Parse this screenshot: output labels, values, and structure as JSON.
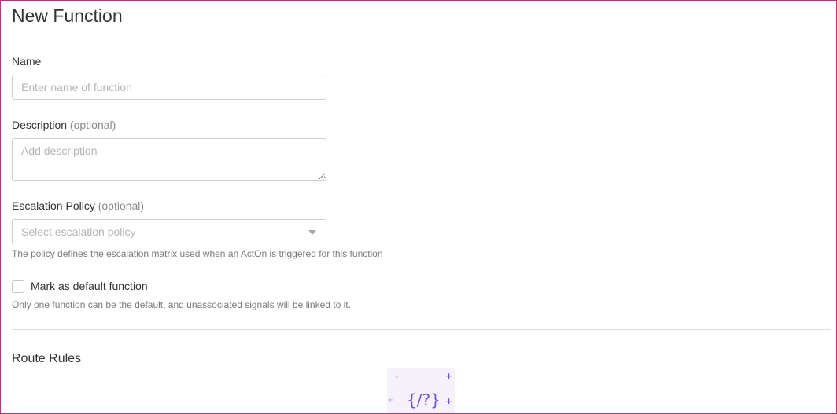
{
  "page": {
    "title": "New Function"
  },
  "name_field": {
    "label": "Name",
    "placeholder": "Enter name of function",
    "value": ""
  },
  "description_field": {
    "label": "Description",
    "optional_label": "(optional)",
    "placeholder": "Add description",
    "value": ""
  },
  "escalation_field": {
    "label": "Escalation Policy",
    "optional_label": "(optional)",
    "placeholder": "Select escalation policy",
    "help_text": "The policy defines the escalation matrix used when an ActOn is triggered for this function",
    "caret_icon": "chevron-down-icon"
  },
  "default_function": {
    "label": "Mark as default function",
    "checked": false,
    "help_text": "Only one function can be the default, and unassociated signals will be linked to it."
  },
  "route_rules": {
    "title": "Route Rules",
    "illustration_text": "{/?}",
    "illustration_icon": "code-query-icon",
    "plus_glyph": "+"
  },
  "colors": {
    "frame_border": "#b5357a",
    "accent": "#6e56cf",
    "illustration_bg": "#f5f2fc"
  }
}
